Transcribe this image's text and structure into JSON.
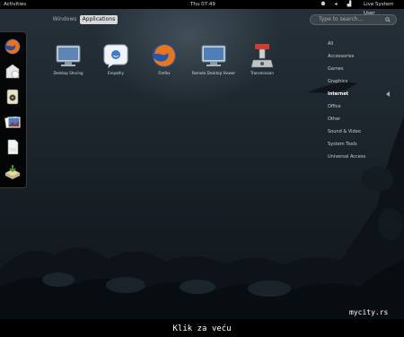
{
  "topbar": {
    "activities": "Activities",
    "clock": "Thu 07:49",
    "user": "Live System User",
    "icons": [
      "accessibility-icon",
      "volume-icon",
      "network-icon"
    ]
  },
  "overview": {
    "windows_label": "Windows",
    "applications_label": "Applications",
    "search_placeholder": "Type to search..."
  },
  "dash": {
    "items": [
      "firefox-icon",
      "evolution-icon",
      "rhythmbox-icon",
      "shotwell-icon",
      "document-icon",
      "software-install-icon"
    ]
  },
  "apps": [
    {
      "label": "Desktop Sharing",
      "icon": "desktop-sharing-icon"
    },
    {
      "label": "Empathy",
      "icon": "empathy-icon"
    },
    {
      "label": "Firefox",
      "icon": "firefox-icon"
    },
    {
      "label": "Remote Desktop Viewer",
      "icon": "remote-desktop-icon"
    },
    {
      "label": "Transmission",
      "icon": "transmission-icon"
    }
  ],
  "categories": {
    "items": [
      "All",
      "Accessories",
      "Games",
      "Graphics",
      "Internet",
      "Office",
      "Other",
      "Sound & Video",
      "System Tools",
      "Universal Access"
    ],
    "selected": "Internet"
  },
  "watermark": "mycity.rs",
  "caption": "Klik za veću"
}
